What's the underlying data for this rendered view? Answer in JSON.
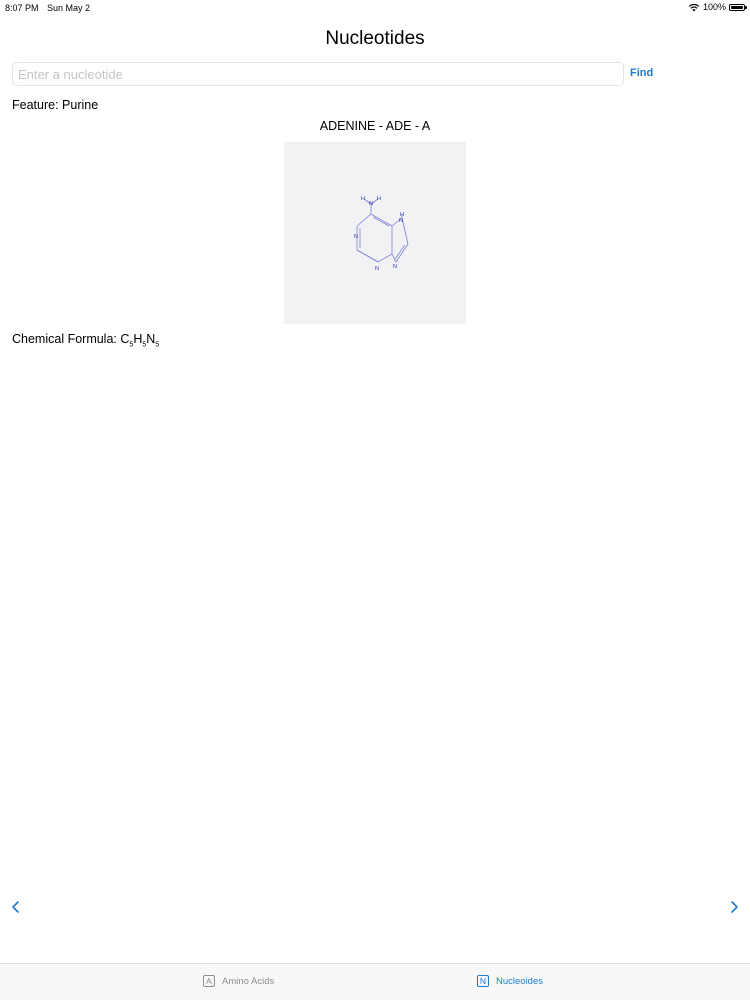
{
  "status_bar": {
    "time": "8:07 PM",
    "date": "Sun May 2",
    "battery": "100%"
  },
  "nav": {
    "title": "Nucleotides"
  },
  "search": {
    "placeholder": "Enter a nucleotide",
    "value": "",
    "find_label": "Find"
  },
  "nucleotide": {
    "feature": "Feature: Purine",
    "name": "ADENINE - ADE - A",
    "formula_label": "Chemical Formula: ",
    "formula": [
      {
        "el": "C",
        "n": "5"
      },
      {
        "el": "H",
        "n": "5"
      },
      {
        "el": "N",
        "n": "5"
      }
    ]
  },
  "structure": {
    "atom_labels": [
      "H",
      "H",
      "N",
      "H",
      "N",
      "N",
      "N",
      "N"
    ],
    "bond_color": "#7a7fd6",
    "label_color": "#2a30a8"
  },
  "tab_bar": {
    "tabs": [
      {
        "icon": "A",
        "label": "Amino Acids",
        "selected": false
      },
      {
        "icon": "N",
        "label": "Nucleoides",
        "selected": true
      }
    ]
  },
  "colors": {
    "accent": "#1a7bd1",
    "inactive": "#8e8e93"
  }
}
